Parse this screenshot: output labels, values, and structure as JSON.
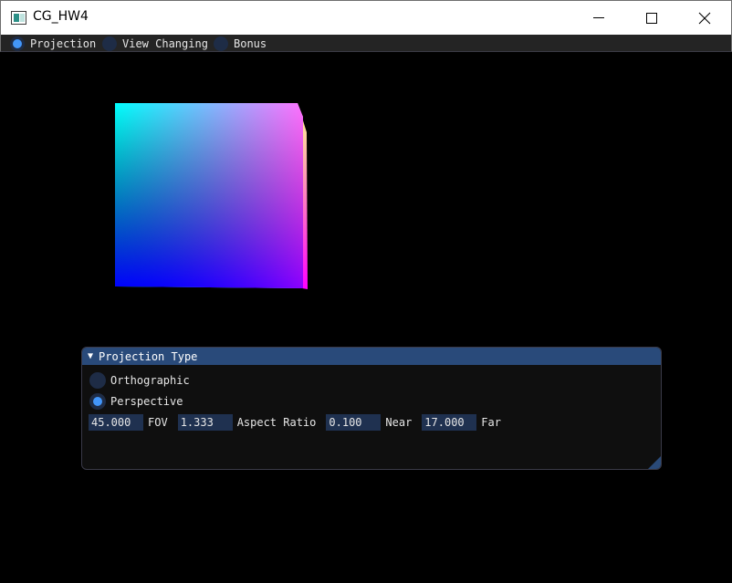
{
  "window": {
    "title": "CG_HW4",
    "icon": "window-app-icon",
    "controls": [
      "minimize-icon",
      "maximize-icon",
      "close-icon"
    ]
  },
  "menubar": {
    "items": [
      {
        "label": "Projection",
        "selected": true
      },
      {
        "label": "View Changing",
        "selected": false
      },
      {
        "label": "Bonus",
        "selected": false
      }
    ]
  },
  "panel": {
    "title": "Projection Type",
    "options": [
      {
        "label": "Orthographic",
        "selected": false
      },
      {
        "label": "Perspective",
        "selected": true
      }
    ],
    "fields": [
      {
        "value": "45.000",
        "label": "FOV"
      },
      {
        "value": "1.333",
        "label": "Aspect Ratio"
      },
      {
        "value": "0.100",
        "label": "Near"
      },
      {
        "value": "17.000",
        "label": "Far"
      }
    ]
  },
  "colors": {
    "accent": "#4296fa",
    "header": "#294a7a",
    "frame_bg": "#1f3150"
  }
}
